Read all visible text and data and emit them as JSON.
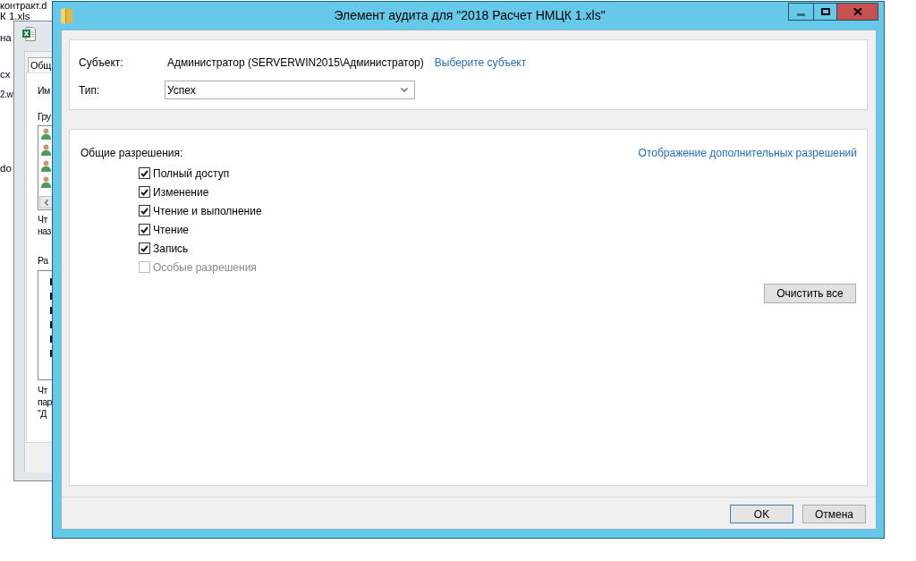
{
  "explorer_files": [
    {
      "name": "контракт.d"
    },
    {
      "name": "К 1.xls"
    },
    {
      "name": "на"
    },
    {
      "name": "сх"
    },
    {
      "name": "2.w"
    },
    {
      "name": "do"
    }
  ],
  "properties_window": {
    "tabs": [
      {
        "label": "Общ",
        "selected": true
      }
    ],
    "name_label": "Им",
    "groups_label": "Гру",
    "groups_hint": [
      "Чт",
      "наз"
    ],
    "permissions_label": "Ра",
    "permissions_hint": [
      "Чт",
      "пар",
      "\"Д"
    ]
  },
  "audit_dialog": {
    "title": "Элемент аудита для \"2018 Расчет НМЦК 1.xls\"",
    "principal": {
      "label": "Субъект:",
      "value": "Администратор (SERVERWIN2015\\Администратор)",
      "link": "Выберите субъект"
    },
    "type": {
      "label": "Тип:",
      "value": "Успех"
    },
    "permissions": {
      "label": "Общие разрешения:",
      "link": "Отображение дополнительных разрешений",
      "items": [
        {
          "label": "Полный доступ",
          "checked": true,
          "disabled": false
        },
        {
          "label": "Изменение",
          "checked": true,
          "disabled": false
        },
        {
          "label": "Чтение и выполнение",
          "checked": true,
          "disabled": false
        },
        {
          "label": "Чтение",
          "checked": true,
          "disabled": false
        },
        {
          "label": "Запись",
          "checked": true,
          "disabled": false
        },
        {
          "label": "Особые разрешения",
          "checked": false,
          "disabled": true
        }
      ],
      "clear_button": "Очистить все"
    },
    "buttons": [
      {
        "label": "OK",
        "default": true
      },
      {
        "label": "Отмена",
        "default": false
      }
    ]
  }
}
